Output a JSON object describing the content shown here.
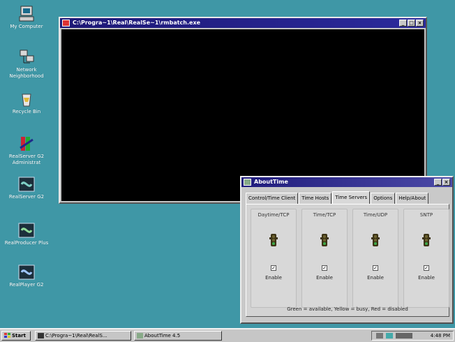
{
  "desktop": {
    "icons": [
      {
        "label": "My Computer"
      },
      {
        "label": "Network Neighborhood"
      },
      {
        "label": "Recycle Bin"
      },
      {
        "label": "RealServer G2 Administrat"
      },
      {
        "label": "RealServer G2"
      },
      {
        "label": "RealProducer Plus"
      },
      {
        "label": "RealPlayer G2"
      }
    ]
  },
  "console_window": {
    "title": "C:\\Progra~1\\Real\\RealSe~1\\rmbatch.exe",
    "buttons": {
      "minimize": "_",
      "maximize": "□",
      "close": "×"
    }
  },
  "about_window": {
    "title": "AboutTime",
    "tabs": [
      {
        "label": "Control/Time Client"
      },
      {
        "label": "Time Hosts"
      },
      {
        "label": "Time Servers"
      },
      {
        "label": "Options"
      },
      {
        "label": "Help/About"
      }
    ],
    "active_tab": "Time Servers",
    "servers": [
      {
        "name": "Daytime/TCP",
        "enable_label": "Enable",
        "checked": true,
        "check_glyph": "✓"
      },
      {
        "name": "Time/TCP",
        "enable_label": "Enable",
        "checked": true,
        "check_glyph": "✓"
      },
      {
        "name": "Time/UDP",
        "enable_label": "Enable",
        "checked": true,
        "check_glyph": "✓"
      },
      {
        "name": "SNTP",
        "enable_label": "Enable",
        "checked": true,
        "check_glyph": "✓"
      }
    ],
    "legend": "Green = available, Yellow = busy, Red = disabled",
    "buttons": {
      "minimize": "_",
      "close": "×"
    }
  },
  "taskbar": {
    "start_label": "Start",
    "items": [
      {
        "label": "C:\\Progra~1\\Real\\RealS..."
      },
      {
        "label": "AboutTime 4.5"
      }
    ],
    "clock": "4:48 PM"
  },
  "colors": {
    "desktop": "#3f97a6",
    "titlebar": "#1d1876",
    "light_body": "#4a3a1a"
  }
}
